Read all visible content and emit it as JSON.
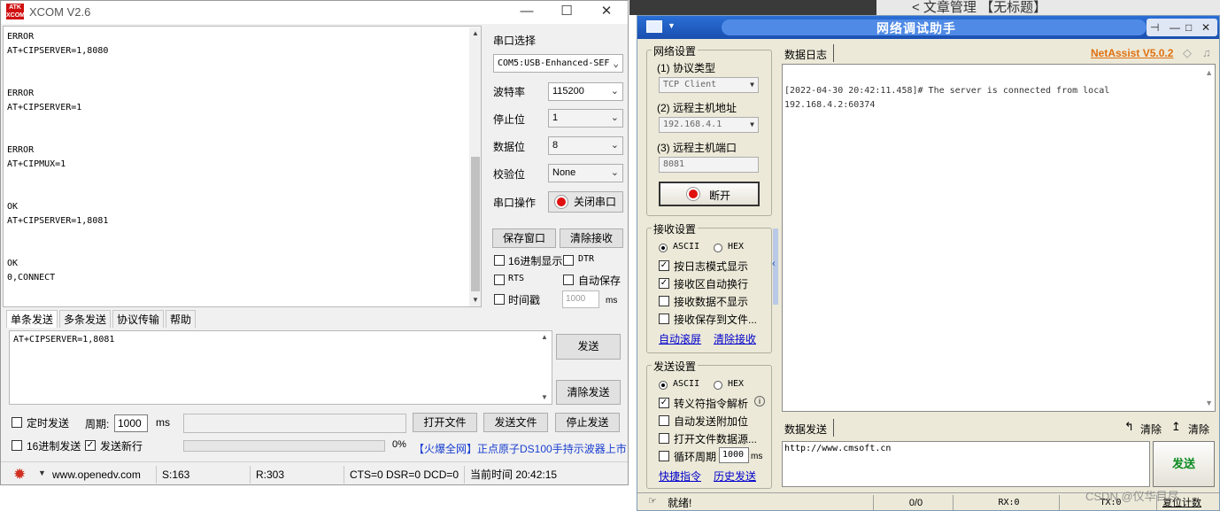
{
  "background": {
    "tab_text": "< 文章管理 【无标题】"
  },
  "xcom": {
    "title": "XCOM V2.6",
    "logo_text": "ATK XCOM",
    "recv_lines": "ERROR\nAT+CIPSERVER=1,8080\n\n\nERROR\nAT+CIPSERVER=1\n\n\nERROR\nAT+CIPMUX=1\n\n\nOK\nAT+CIPSERVER=1,8081\n\n\nOK\n0,CONNECT",
    "port_select_label": "串口选择",
    "port_value": "COM5:USB-Enhanced-SEF",
    "baud_label": "波特率",
    "baud_value": "115200",
    "stop_label": "停止位",
    "stop_value": "1",
    "data_label": "数据位",
    "data_value": "8",
    "parity_label": "校验位",
    "parity_value": "None",
    "port_op_label": "串口操作",
    "close_port_button": "关闭串口",
    "save_window_button": "保存窗口",
    "clear_recv_button": "清除接收",
    "hex_display_label": "16进制显示",
    "dtr_label": "DTR",
    "rts_label": "RTS",
    "auto_save_label": "自动保存",
    "timestamp_label": "时间戳",
    "timestamp_value": "1000",
    "timestamp_unit": "ms",
    "tabs": [
      "单条发送",
      "多条发送",
      "协议传输",
      "帮助"
    ],
    "send_text": "AT+CIPSERVER=1,8081",
    "send_button": "发送",
    "clear_send_button": "清除发送",
    "timed_send_label": "定时发送",
    "period_label": "周期:",
    "period_value": "1000",
    "period_unit": "ms",
    "open_file_button": "打开文件",
    "send_file_button": "发送文件",
    "stop_send_button": "停止发送",
    "hex_send_label": "16进制发送",
    "send_newline_label": "发送新行",
    "progress_text": "0%",
    "ad_text": "【火爆全网】正点原子DS100手持示波器上市",
    "status_url": "www.openedv.com",
    "status_s": "S:163",
    "status_r": "R:303",
    "status_lines": "CTS=0 DSR=0 DCD=0",
    "status_time": "当前时间 20:42:15"
  },
  "net": {
    "title": "网络调试助手",
    "version": "NetAssist V5.0.2",
    "net_settings_title": "网络设置",
    "protocol_label": "(1) 协议类型",
    "protocol_value": "TCP Client",
    "host_label": "(2) 远程主机地址",
    "host_value": "192.168.4.1",
    "port_label": "(3) 远程主机端口",
    "port_value": "8081",
    "disconnect_button": "断开",
    "recv_settings_title": "接收设置",
    "ascii_label": "ASCII",
    "hex_label": "HEX",
    "log_mode_label": "按日志模式显示",
    "auto_wrap_label": "接收区自动换行",
    "no_show_label": "接收数据不显示",
    "save_to_file_label": "接收保存到文件...",
    "auto_scroll_link": "自动滚屏",
    "clear_recv_link": "清除接收",
    "send_settings_title": "发送设置",
    "escape_label": "转义符指令解析",
    "auto_append_label": "自动发送附加位",
    "open_file_src_label": "打开文件数据源...",
    "cycle_label": "循环周期",
    "cycle_value": "1000",
    "cycle_unit": "ms",
    "shortcut_link": "快捷指令",
    "history_link": "历史发送",
    "data_log_label": "数据日志",
    "log_text": "[2022-04-30 20:42:11.458]# The server is connected from local\n192.168.4.2:60374",
    "data_send_label": "数据发送",
    "clear_label_1": "清除",
    "clear_label_2": "清除",
    "send_text": "http://www.cmsoft.cn",
    "send_button": "发送",
    "status_ready": "就绪!",
    "status_count": "0/0",
    "status_rx": "RX:0",
    "status_tx": "TX:0",
    "reset_count": "复位计数",
    "watermark": "CSDN @仪华目尽"
  }
}
